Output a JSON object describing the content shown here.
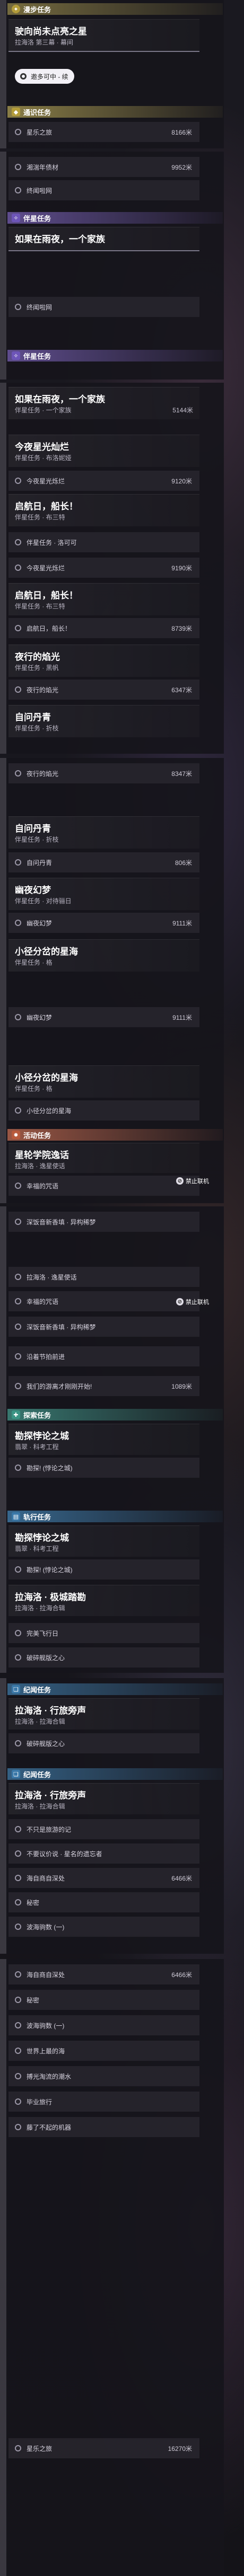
{
  "colors": {
    "story": "#e8d36a",
    "companion": "#8e72d8",
    "event": "#e07a5a",
    "exploration": "#4fb8a6",
    "scroll": "#4e9ed8"
  },
  "labels": {
    "step_follow": "邀多可中 - 续",
    "ban": "禁止联机",
    "ban_icon": "block-icon"
  },
  "sec": {
    "s1": "漫步任务",
    "s2": "通识任务",
    "s3": "伴星任务",
    "s4": "伴星任务",
    "s5": "活动任务",
    "s6": "探索任务",
    "s7": "轨行任务",
    "s8": "纪闻任务",
    "s9": "纪闻任务"
  },
  "cards": {
    "c1": {
      "title": "驶向尚未点亮之星",
      "sub": "拉海洛 第三幕 · 幕间"
    },
    "c2": {
      "title": "如果在雨夜，一个家族"
    },
    "c3": {
      "title": "如果在雨夜，一个家族",
      "sub": "伴星任务 · 一个家族",
      "dist": "5144米"
    },
    "c4": {
      "title": "今夜星光灿烂",
      "sub": "伴星任务 · 布洛妮娅"
    },
    "c5": {
      "title": "启航日，船长！",
      "sub": "伴星任务 · 布三特"
    },
    "c6": {
      "title": "启航日，船长！",
      "sub": "伴星任务 · 布三特",
      "dist": "8739米"
    },
    "c7": {
      "title": "夜行的焰光",
      "sub": "伴星任务 · 黑帆"
    },
    "c8": {
      "title": "自问丹青",
      "sub": "伴星任务 · 折枝"
    },
    "c9": {
      "title": "自问丹青",
      "sub": "伴星任务 · 折枝",
      "dist": "806米"
    },
    "c10": {
      "title": "幽夜幻梦",
      "sub": "伴星任务 · 对待骊日"
    },
    "c11": {
      "title": "小径分岔的星海",
      "sub": "伴星任务 · 格"
    },
    "c12": {
      "title": "小径分岔的星海",
      "sub": "伴星任务 · 格"
    },
    "c13": {
      "title": "星轮学院逸话",
      "sub": "拉海洛 · 逸星使话"
    },
    "c14": {
      "title": "勘探悖论之城",
      "sub": "翡翠 · 科考工程"
    },
    "c15": {
      "title": "勘探悖论之城",
      "sub": "翡翠 · 科考工程"
    },
    "c16": {
      "title": "拉海洛 · 极城踏勘",
      "sub": "拉海洛 · 拉海合辑"
    },
    "c17": {
      "title": "拉海洛 · 行旅旁声",
      "sub": "拉海洛 · 拉海合辑"
    },
    "c18": {
      "title": "拉海洛 · 行旅旁声",
      "sub": "拉海洛 · 拉海合辑"
    }
  },
  "steps": {
    "a1": {
      "label": "星乐之旅",
      "dist": "8166米"
    },
    "a2": {
      "label": "湘湍年债材",
      "dist": "9952米"
    },
    "a3": {
      "label": "终闻啦网"
    },
    "a4": {
      "label": "终闻啦网"
    },
    "a5": {
      "label": "今夜星光烁烂",
      "dist": "9120米"
    },
    "a6": {
      "label": "伴星任务 · 洛可可"
    },
    "a7": {
      "label": "今夜星光烁烂",
      "dist": "9190米"
    },
    "a8": {
      "label": "启航日，船长！"
    },
    "a9": {
      "label": "夜行的焰光",
      "dist": "6347米"
    },
    "a10": {
      "label": "夜行的焰光",
      "dist": "8347米"
    },
    "a11": {
      "label": "自问丹青",
      "dist": ""
    },
    "a12": {
      "label": "幽夜幻梦",
      "dist": "9111米"
    },
    "a13": {
      "label": "幽夜幻梦",
      "dist": "9111米"
    },
    "a14": {
      "label": "小径分岔的星海"
    },
    "a15": {
      "label": "幸福的咒语"
    },
    "a16": {
      "label": "深饭音新香填 · 异构稀梦"
    },
    "a17": {
      "label": "拉海洛 · 逸星使话"
    },
    "a18": {
      "label": "幸福的咒语"
    },
    "a19": {
      "label": "深饭音新香填 · 异构稀梦"
    },
    "a20": {
      "label": "沿着节拍前进"
    },
    "a21": {
      "label": "我们的游离才刚刚开始!",
      "dist": "1089米"
    },
    "a22": {
      "label": "勘探! (悖论之城)"
    },
    "a23": {
      "label": "勘探! (悖论之城)"
    },
    "a24": {
      "label": "完美飞行日"
    },
    "a25": {
      "label": "破碎舰版之心"
    },
    "a26": {
      "label": "破碎舰版之心"
    },
    "a27": {
      "label": "不只是旅游的记"
    },
    "a28": {
      "label": "不要议价说 · 星名的遗忘者"
    },
    "a29": {
      "label": "海自商自深处",
      "dist": "6466米"
    },
    "a30": {
      "label": "秘密"
    },
    "a31": {
      "label": "波海驹数 (一)"
    },
    "a32": {
      "label": "海自商自深处",
      "dist": "6466米"
    },
    "a33": {
      "label": "秘密"
    },
    "a34": {
      "label": "波海驹数 (一)"
    },
    "a35": {
      "label": "世界上最的海"
    },
    "a36": {
      "label": "搏光淘流的潮水"
    },
    "a37": {
      "label": "毕业旅行"
    },
    "a38": {
      "label": "藤了不起的机器"
    },
    "a39": {
      "label": "星乐之旅",
      "dist": "16270米"
    }
  }
}
